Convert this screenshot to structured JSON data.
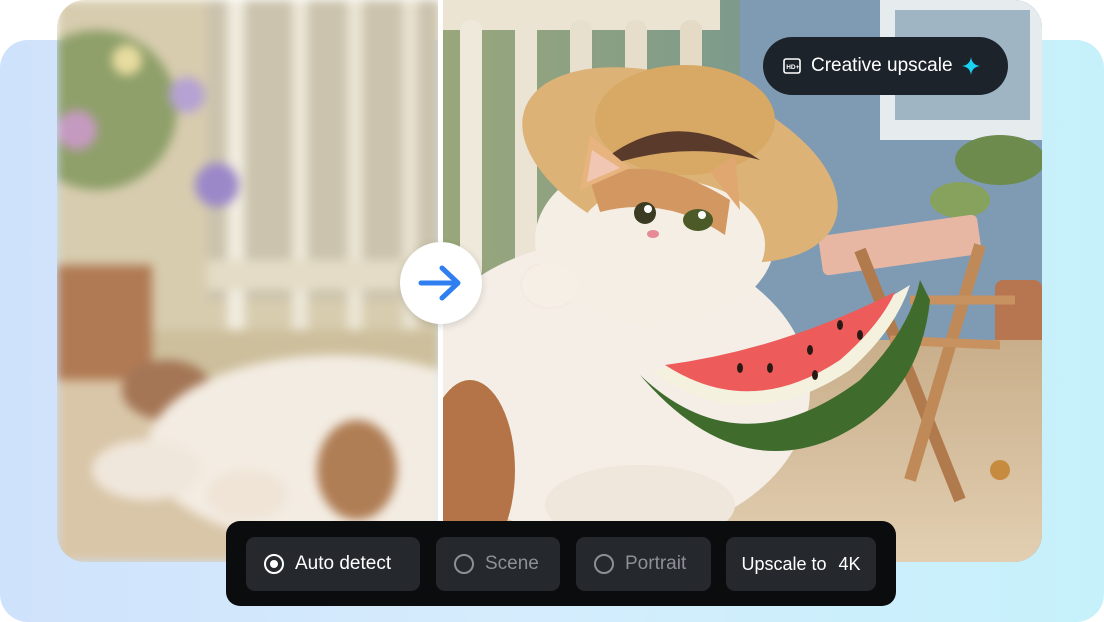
{
  "badge": {
    "label": "Creative upscale",
    "icon": "hd-plus-icon",
    "spark_icon": "sparkle-icon",
    "spark_color": "#19d3f5"
  },
  "compare": {
    "arrow_icon": "arrow-right-icon",
    "arrow_color": "#2f7ff0"
  },
  "toolbar": {
    "modes": [
      {
        "label": "Auto detect",
        "selected": true
      },
      {
        "label": "Scene",
        "selected": false
      },
      {
        "label": "Portrait",
        "selected": false
      }
    ],
    "upscale_label": "Upscale to",
    "upscale_value": "4K"
  },
  "colors": {
    "toolbar_bg": "#0b0c0e",
    "option_bg": "#25282d",
    "badge_bg": "#1d232b"
  }
}
